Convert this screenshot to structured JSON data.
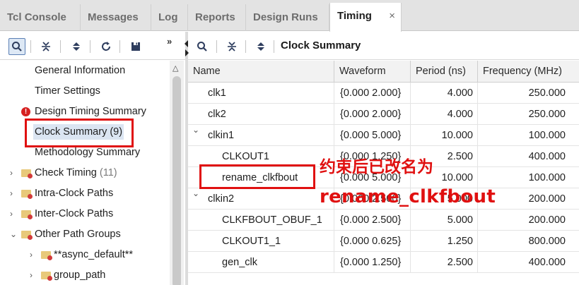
{
  "tabs": [
    {
      "label": "Tcl Console",
      "active": false
    },
    {
      "label": "Messages",
      "active": false
    },
    {
      "label": "Log",
      "active": false
    },
    {
      "label": "Reports",
      "active": false
    },
    {
      "label": "Design Runs",
      "active": false
    },
    {
      "label": "Timing",
      "active": true,
      "close": "×"
    }
  ],
  "left_toolbar": {
    "icons": [
      "search-icon",
      "collapse-all-icon",
      "expand-all-icon",
      "refresh-icon",
      "save-icon"
    ],
    "more": "»"
  },
  "right_toolbar": {
    "icons": [
      "search-icon",
      "collapse-all-icon",
      "expand-all-icon"
    ],
    "title": "Clock Summary"
  },
  "tree": [
    {
      "label": "General Information"
    },
    {
      "label": "Timer Settings"
    },
    {
      "label": "Design Timing Summary",
      "icon": "error-icon"
    },
    {
      "label": "Clock Summary (9)",
      "selected": true
    },
    {
      "label": "Methodology Summary"
    },
    {
      "label": "Check Timing",
      "count": "(11)",
      "expand": "collapsed"
    },
    {
      "label": "Intra-Clock Paths",
      "expand": "collapsed"
    },
    {
      "label": "Inter-Clock Paths",
      "expand": "collapsed"
    },
    {
      "label": "Other Path Groups",
      "expand": "expanded"
    },
    {
      "label": "**async_default**",
      "expand": "collapsed"
    },
    {
      "label": "group_path",
      "expand": "collapsed"
    }
  ],
  "table": {
    "columns": [
      "Name",
      "Waveform",
      "Period (ns)",
      "Frequency (MHz)"
    ],
    "rows": [
      {
        "name": "clk1",
        "waveform": "{0.000 2.000}",
        "period": "4.000",
        "frequency": "250.000"
      },
      {
        "name": "clk2",
        "waveform": "{0.000 2.000}",
        "period": "4.000",
        "frequency": "250.000"
      },
      {
        "name": "clkin1",
        "waveform": "{0.000 5.000}",
        "period": "10.000",
        "frequency": "100.000",
        "expand": "expanded"
      },
      {
        "name": "CLKOUT1",
        "waveform": "{0.000 1.250}",
        "period": "2.500",
        "frequency": "400.000"
      },
      {
        "name": "rename_clkfbout",
        "waveform": "{0.000 5.000}",
        "period": "10.000",
        "frequency": "100.000"
      },
      {
        "name": "clkin2",
        "waveform": "{0.000 2.500}",
        "period": "5.000",
        "frequency": "200.000",
        "expand": "expanded"
      },
      {
        "name": "CLKFBOUT_OBUF_1",
        "waveform": "{0.000 2.500}",
        "period": "5.000",
        "frequency": "200.000"
      },
      {
        "name": "CLKOUT1_1",
        "waveform": "{0.000 0.625}",
        "period": "1.250",
        "frequency": "800.000"
      },
      {
        "name": "gen_clk",
        "waveform": "{0.000 1.250}",
        "period": "2.500",
        "frequency": "400.000"
      }
    ]
  },
  "annotations": {
    "line1": "约束后已改名为",
    "line2": "rename_clkfbout",
    "color": "#e01010"
  },
  "colors": {
    "tab_bar_bg": "#e3e3e3",
    "selection_bg": "#dbe5f2",
    "annotation_red": "#e01010"
  }
}
